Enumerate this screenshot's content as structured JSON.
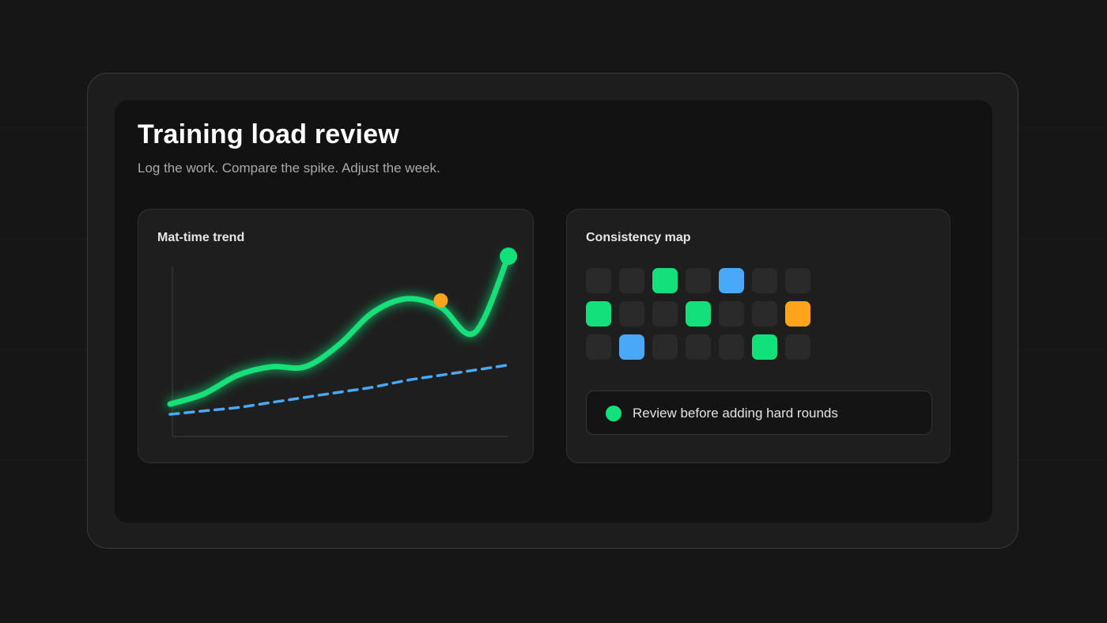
{
  "header": {
    "title": "Training load review",
    "subtitle": "Log the work. Compare the spike. Adjust the week."
  },
  "trend_card": {
    "title": "Mat-time trend"
  },
  "map_card": {
    "title": "Consistency map",
    "rows": [
      [
        "empty",
        "empty",
        "green",
        "empty",
        "blue",
        "empty",
        "empty"
      ],
      [
        "green",
        "empty",
        "empty",
        "green",
        "empty",
        "empty",
        "orange"
      ],
      [
        "empty",
        "blue",
        "empty",
        "empty",
        "empty",
        "green",
        "empty"
      ]
    ],
    "callout_text": "Review before adding hard rounds"
  },
  "colors": {
    "green": "#12e07a",
    "blue": "#4aa8f8",
    "orange": "#ffa41b",
    "empty": "#2a2a2a"
  },
  "chart_data": {
    "type": "line",
    "title": "Mat-time trend",
    "xlabel": "",
    "ylabel": "",
    "grid": false,
    "x": [
      0,
      1,
      2,
      3,
      4,
      5,
      6,
      7,
      8,
      9,
      10
    ],
    "xlim": [
      0,
      10
    ],
    "ylim": [
      0,
      100
    ],
    "series": [
      {
        "style": "solid",
        "color": "#12e07a",
        "glow": true,
        "values": [
          19,
          25,
          36,
          41,
          41,
          54,
          73,
          81,
          76,
          61,
          106
        ],
        "highlights": [
          {
            "x": 8,
            "y": 80,
            "color": "#ffa41b"
          },
          {
            "x": 10,
            "y": 106,
            "color": "#12e07a"
          }
        ]
      },
      {
        "style": "dashed",
        "color": "#4aa8f8",
        "glow": false,
        "values": [
          13,
          15,
          17,
          20,
          23,
          26,
          29,
          33,
          36,
          39,
          42
        ]
      }
    ]
  }
}
